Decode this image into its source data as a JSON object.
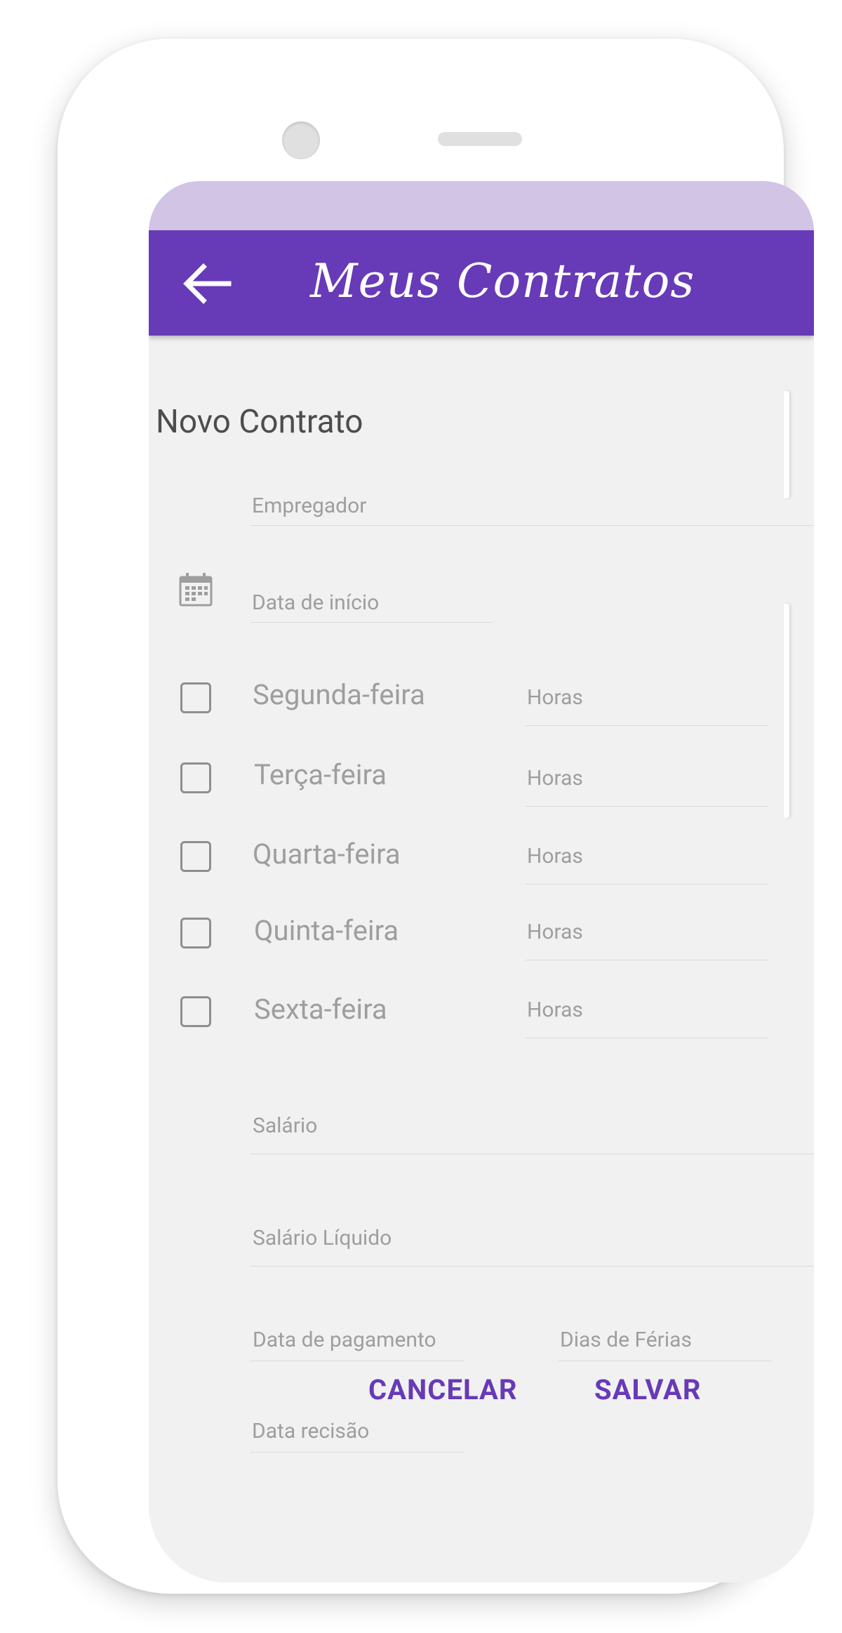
{
  "app_bar": {
    "title": "Meus Contratos",
    "back_icon": "arrow-back-icon",
    "color": "#673ab7",
    "status_bar_color": "#d1c4e5"
  },
  "form": {
    "title": "Novo Contrato",
    "employer_placeholder": "Empregador",
    "start_date_placeholder": "Data de início",
    "calendar_icon": "calendar-icon",
    "days": [
      {
        "label": "Segunda-feira",
        "hours_placeholder": "Horas",
        "checked": false
      },
      {
        "label": "Terça-feira",
        "hours_placeholder": "Horas",
        "checked": false
      },
      {
        "label": "Quarta-feira",
        "hours_placeholder": "Horas",
        "checked": false
      },
      {
        "label": "Quinta-feira",
        "hours_placeholder": "Horas",
        "checked": false
      },
      {
        "label": "Sexta-feira",
        "hours_placeholder": "Horas",
        "checked": false
      }
    ],
    "salary_placeholder": "Salário",
    "net_salary_placeholder": "Salário Líquido",
    "payment_date_placeholder": "Data de pagamento",
    "vacation_days_placeholder": "Dias de Férias",
    "termination_date_placeholder": "Data recisão"
  },
  "actions": {
    "cancel_label": "CANCELAR",
    "save_label": "SALVAR",
    "accent_color": "#673ab7"
  }
}
